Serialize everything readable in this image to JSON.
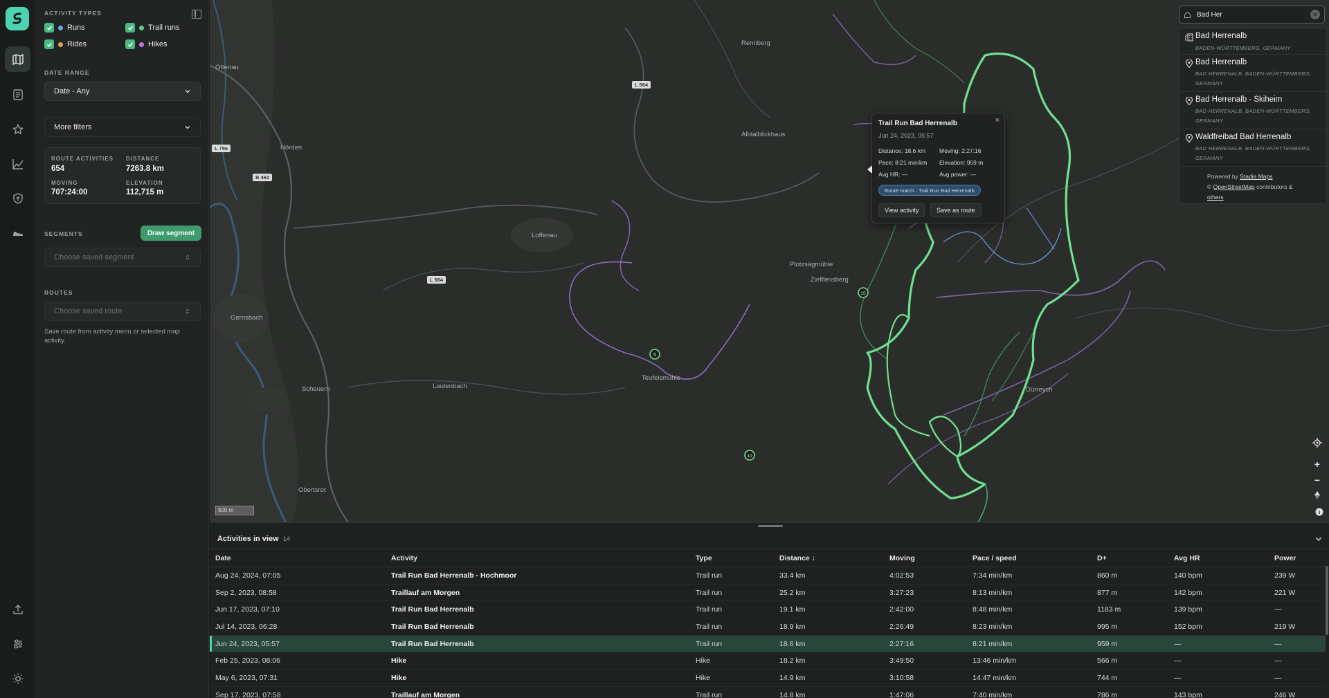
{
  "rail": {
    "items": [
      "logo",
      "map-icon",
      "list-icon",
      "star-icon",
      "chart-icon",
      "shield-icon",
      "shoe-icon"
    ],
    "bottom_items": [
      "upload-icon",
      "sliders-icon",
      "sun-icon"
    ]
  },
  "filters": {
    "activity_types_label": "ACTIVITY TYPES",
    "types": [
      {
        "label": "Runs",
        "color": "#6fa6e8",
        "checked": true
      },
      {
        "label": "Trail runs",
        "color": "#5fd08a",
        "checked": true
      },
      {
        "label": "Rides",
        "color": "#e0a050",
        "checked": true
      },
      {
        "label": "Hikes",
        "color": "#b77ae0",
        "checked": true
      }
    ],
    "date_range_label": "DATE RANGE",
    "date_range_value": "Date - Any",
    "more_filters_label": "More filters",
    "stats": {
      "route_activities_label": "ROUTE ACTIVITIES",
      "route_activities_value": "654",
      "distance_label": "DISTANCE",
      "distance_value": "7263.8 km",
      "moving_label": "MOVING",
      "moving_value": "707:24:00",
      "elevation_label": "ELEVATION",
      "elevation_value": "112,715 m"
    },
    "segments_label": "SEGMENTS",
    "draw_segment_label": "Draw segment",
    "segment_placeholder": "Choose saved segment",
    "routes_label": "ROUTES",
    "route_placeholder": "Choose saved route",
    "routes_hint": "Save route from activity menu or selected map activity."
  },
  "map": {
    "places": [
      {
        "name": "Ottenau"
      },
      {
        "name": "Hörden"
      },
      {
        "name": "Loffenau"
      },
      {
        "name": "Gernsbach"
      },
      {
        "name": "Scheuern"
      },
      {
        "name": "Lautenbach"
      },
      {
        "name": "Obertsrot"
      },
      {
        "name": "Albtalblickhaus"
      },
      {
        "name": "Plotzsägmühle"
      },
      {
        "name": "Ziefflensberg"
      },
      {
        "name": "Teufelsmühle"
      },
      {
        "name": "Dürreych"
      },
      {
        "name": "Rennberg"
      }
    ],
    "road_badges": [
      "L 564",
      "L 79a",
      "B 462",
      "L 564"
    ],
    "scale_label": "500 m",
    "markers": [
      "5",
      "15",
      "10"
    ]
  },
  "popup": {
    "title": "Trail Run Bad Herrenalb",
    "date": "Jun 24, 2023, 05:57",
    "distance": "Distance: 18.6 km",
    "moving": "Moving: 2:27:16",
    "pace": "Pace: 8:21 min/km",
    "elevation": "Elevation: 959 m",
    "avg_hr": "Avg HR: —",
    "avg_power": "Avg power: —",
    "badge": "Route match · Trail Run Bad Herrenalb",
    "view_label": "View activity",
    "save_label": "Save as route",
    "close": "×"
  },
  "search": {
    "value": "Bad Her",
    "results": [
      {
        "name": "Bad Herrenalb",
        "sub": "BADEN-WÜRTTEMBERG, GERMANY",
        "icon": "building-icon"
      },
      {
        "name": "Bad Herrenalb",
        "sub": "BAD HERRENALB, BADEN-WÜRTTEMBERG, GERMANY",
        "icon": "pin-icon"
      },
      {
        "name": "Bad Herrenalb - Skiheim",
        "sub": "BAD HERRENALB, BADEN-WÜRTTEMBERG, GERMANY",
        "icon": "pin-icon"
      },
      {
        "name": "Waldfreibad Bad Herrenalb",
        "sub": "BAD HERRENALB, BADEN-WÜRTTEMBERG, GERMANY",
        "icon": "pin-icon"
      }
    ],
    "powered_by": "Powered by",
    "stadia": "Stadia Maps",
    "copyright": "©",
    "osm": "OpenStreetMap",
    "contributors": "contributors &",
    "others": "others"
  },
  "table": {
    "title": "Activities in view",
    "count": "14",
    "columns": [
      "Date",
      "Activity",
      "Type",
      "Distance ↓",
      "Moving",
      "Pace / speed",
      "D+",
      "Avg HR",
      "Power"
    ],
    "rows": [
      [
        "Aug 24, 2024, 07:05",
        "Trail Run Bad Herrenalb - Hochmoor",
        "Trail run",
        "33.4 km",
        "4:02:53",
        "7:34 min/km",
        "860 m",
        "140 bpm",
        "239 W"
      ],
      [
        "Sep 2, 2023, 08:58",
        "Traillauf am Morgen",
        "Trail run",
        "25.2 km",
        "3:27:23",
        "8:13 min/km",
        "877 m",
        "142 bpm",
        "221 W"
      ],
      [
        "Jun 17, 2023, 07:10",
        "Trail Run Bad Herrenalb",
        "Trail run",
        "19.1 km",
        "2:42:00",
        "8:48 min/km",
        "1183 m",
        "139 bpm",
        "—"
      ],
      [
        "Jul 14, 2023, 06:28",
        "Trail Run Bad Herrenalb",
        "Trail run",
        "18.9 km",
        "2:26:49",
        "8:23 min/km",
        "995 m",
        "152 bpm",
        "219 W"
      ],
      [
        "Jun 24, 2023, 05:57",
        "Trail Run Bad Herrenalb",
        "Trail run",
        "18.6 km",
        "2:27:16",
        "8:21 min/km",
        "959 m",
        "—",
        "—"
      ],
      [
        "Feb 25, 2023, 08:06",
        "Hike",
        "Hike",
        "18.2 km",
        "3:49:50",
        "13:46 min/km",
        "566 m",
        "—",
        "—"
      ],
      [
        "May 6, 2023, 07:31",
        "Hike",
        "Hike",
        "14.9 km",
        "3:10:58",
        "14:47 min/km",
        "744 m",
        "—",
        "—"
      ],
      [
        "Sep 17, 2023, 07:58",
        "Traillauf am Morgen",
        "Trail run",
        "14.8 km",
        "1:47:06",
        "7:40 min/km",
        "786 m",
        "143 bpm",
        "246 W"
      ]
    ],
    "selected_row": 4
  }
}
